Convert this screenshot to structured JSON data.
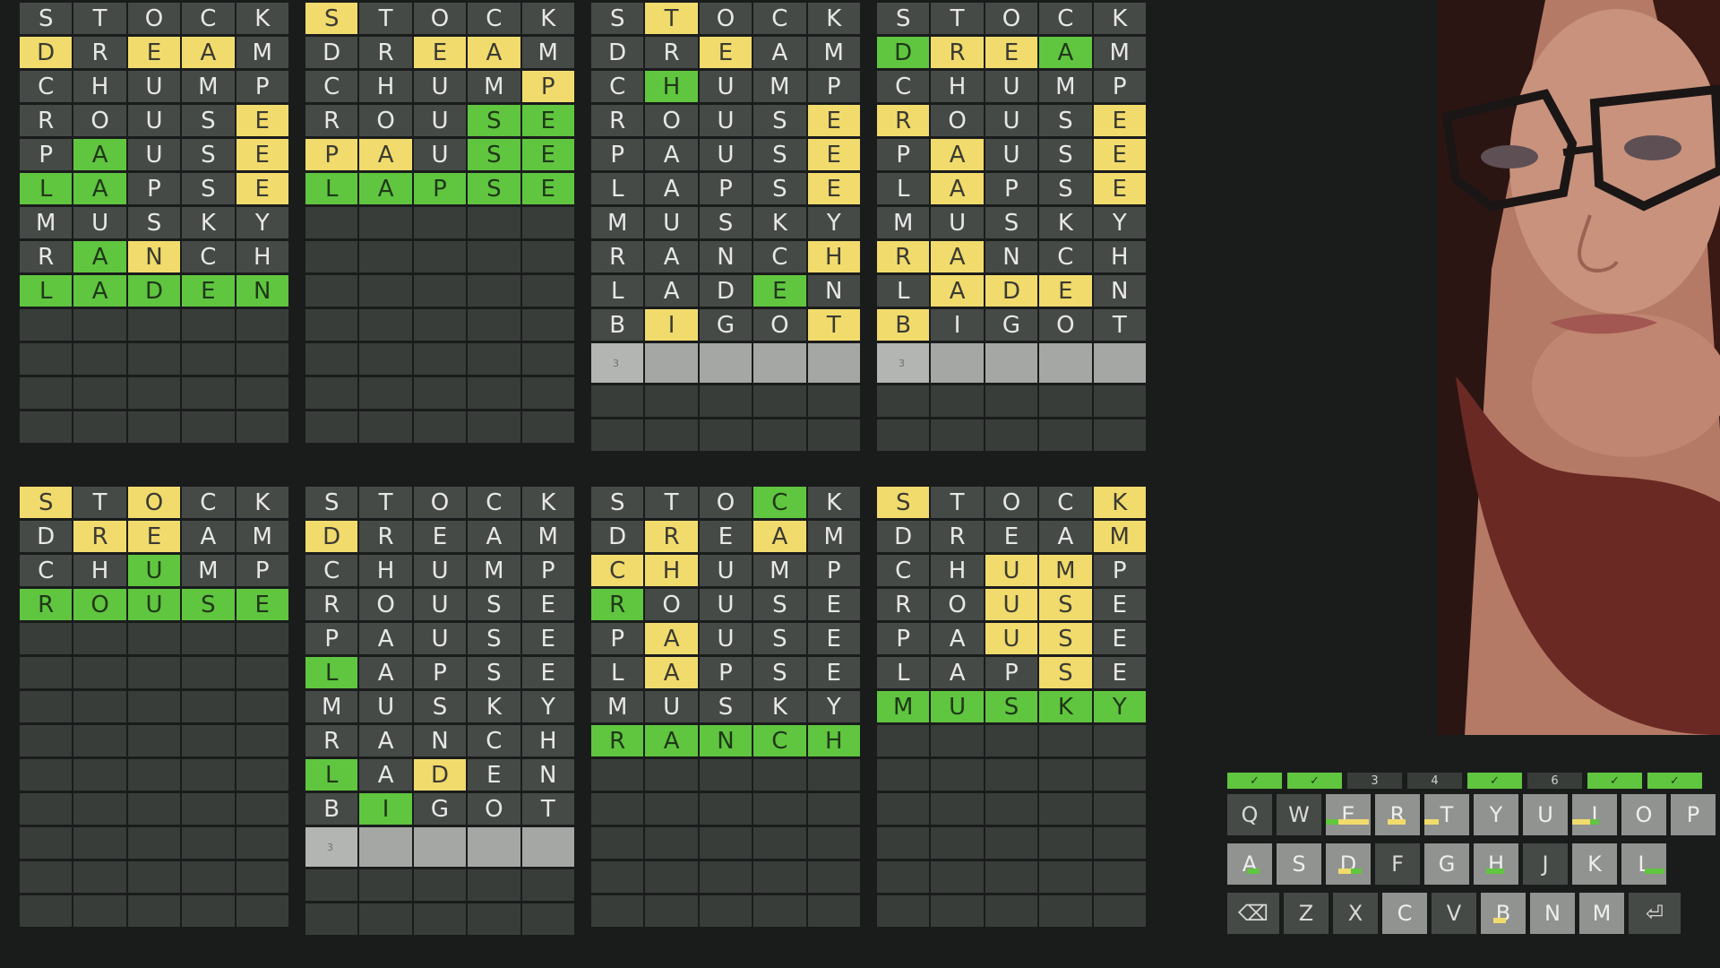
{
  "colors": {
    "background": "#1a1c1c",
    "empty_tile": "#393d3a",
    "guessed_tile": "#464a47",
    "yellow": "#f1db6c",
    "green": "#60c53f"
  },
  "guesses": [
    "STOCK",
    "DREAM",
    "CHUMP",
    "ROUSE",
    "PAUSE",
    "LAPSE",
    "MUSKY",
    "RANCH",
    "LADEN",
    "BIGOT"
  ],
  "boards": [
    {
      "status": "solved",
      "answer": "LADEN",
      "rows": [
        {
          "word": "STOCK",
          "s": "....."
        },
        {
          "word": "DREAM",
          "s": "y.yy."
        },
        {
          "word": "CHUMP",
          "s": "....."
        },
        {
          "word": "ROUSE",
          "s": "....y"
        },
        {
          "word": "PAUSE",
          "s": ".g..y"
        },
        {
          "word": "LAPSE",
          "s": "gg..y"
        },
        {
          "word": "MUSKY",
          "s": "....."
        },
        {
          "word": "RANCH",
          "s": ".gy.."
        },
        {
          "word": "LADEN",
          "s": "ggggg"
        }
      ],
      "current_row_hint": ""
    },
    {
      "status": "solved",
      "answer": "LAPSE",
      "rows": [
        {
          "word": "STOCK",
          "s": "y...."
        },
        {
          "word": "DREAM",
          "s": "..yy."
        },
        {
          "word": "CHUMP",
          "s": "....y"
        },
        {
          "word": "ROUSE",
          "s": "...gg"
        },
        {
          "word": "PAUSE",
          "s": "yy.gg"
        },
        {
          "word": "LAPSE",
          "s": "ggggg"
        }
      ],
      "current_row_hint": ""
    },
    {
      "status": "active",
      "rows": [
        {
          "word": "STOCK",
          "s": ".y..."
        },
        {
          "word": "DREAM",
          "s": "..y.."
        },
        {
          "word": "CHUMP",
          "s": ".g..."
        },
        {
          "word": "ROUSE",
          "s": "....y"
        },
        {
          "word": "PAUSE",
          "s": "....y"
        },
        {
          "word": "LAPSE",
          "s": "....y"
        },
        {
          "word": "MUSKY",
          "s": "....."
        },
        {
          "word": "RANCH",
          "s": "....y"
        },
        {
          "word": "LADEN",
          "s": "...g."
        },
        {
          "word": "BIGOT",
          "s": ".y..y"
        }
      ],
      "current_row_hint": "3"
    },
    {
      "status": "active",
      "rows": [
        {
          "word": "STOCK",
          "s": "....."
        },
        {
          "word": "DREAM",
          "s": "gyyg."
        },
        {
          "word": "CHUMP",
          "s": "....."
        },
        {
          "word": "ROUSE",
          "s": "y...y"
        },
        {
          "word": "PAUSE",
          "s": ".y..y"
        },
        {
          "word": "LAPSE",
          "s": ".y..y"
        },
        {
          "word": "MUSKY",
          "s": "....."
        },
        {
          "word": "RANCH",
          "s": "yy..."
        },
        {
          "word": "LADEN",
          "s": ".yyy."
        },
        {
          "word": "BIGOT",
          "s": "y...."
        }
      ],
      "current_row_hint": "3"
    },
    {
      "status": "solved",
      "answer": "ROUSE",
      "rows": [
        {
          "word": "STOCK",
          "s": "y.y.."
        },
        {
          "word": "DREAM",
          "s": ".yy.."
        },
        {
          "word": "CHUMP",
          "s": "..g.."
        },
        {
          "word": "ROUSE",
          "s": "ggggg"
        }
      ],
      "current_row_hint": ""
    },
    {
      "status": "active",
      "rows": [
        {
          "word": "STOCK",
          "s": "....."
        },
        {
          "word": "DREAM",
          "s": "y...."
        },
        {
          "word": "CHUMP",
          "s": "....."
        },
        {
          "word": "ROUSE",
          "s": "....."
        },
        {
          "word": "PAUSE",
          "s": "....."
        },
        {
          "word": "LAPSE",
          "s": "g...."
        },
        {
          "word": "MUSKY",
          "s": "....."
        },
        {
          "word": "RANCH",
          "s": "....."
        },
        {
          "word": "LADEN",
          "s": "g.y.."
        },
        {
          "word": "BIGOT",
          "s": ".g..."
        }
      ],
      "current_row_hint": "3"
    },
    {
      "status": "solved",
      "answer": "RANCH",
      "rows": [
        {
          "word": "STOCK",
          "s": "...g."
        },
        {
          "word": "DREAM",
          "s": ".y.y."
        },
        {
          "word": "CHUMP",
          "s": "yy..."
        },
        {
          "word": "ROUSE",
          "s": "g...."
        },
        {
          "word": "PAUSE",
          "s": ".y..."
        },
        {
          "word": "LAPSE",
          "s": ".y..."
        },
        {
          "word": "MUSKY",
          "s": "....."
        },
        {
          "word": "RANCH",
          "s": "ggggg"
        }
      ],
      "current_row_hint": ""
    },
    {
      "status": "solved",
      "answer": "MUSKY",
      "rows": [
        {
          "word": "STOCK",
          "s": "y...y"
        },
        {
          "word": "DREAM",
          "s": "....y"
        },
        {
          "word": "CHUMP",
          "s": "..yy."
        },
        {
          "word": "ROUSE",
          "s": "..yy."
        },
        {
          "word": "PAUSE",
          "s": "..yy."
        },
        {
          "word": "LAPSE",
          "s": "...y."
        },
        {
          "word": "MUSKY",
          "s": "ggggg"
        }
      ],
      "current_row_hint": ""
    }
  ],
  "keyboard": {
    "board_indicators": [
      "✓",
      "✓",
      "3",
      "4",
      "✓",
      "6",
      "✓",
      "✓"
    ],
    "rows": [
      [
        {
          "k": "Q",
          "style": "dark"
        },
        {
          "k": "W",
          "style": "dark"
        },
        {
          "k": "E",
          "style": "light",
          "marks": [
            {
              "c": "g",
              "l": 0,
              "w": 14
            },
            {
              "c": "y",
              "l": 14,
              "w": 34
            }
          ]
        },
        {
          "k": "R",
          "style": "light",
          "marks": [
            {
              "c": "y",
              "l": 14,
              "w": 20
            }
          ]
        },
        {
          "k": "T",
          "style": "light",
          "marks": [
            {
              "c": "y",
              "l": 0,
              "w": 16
            }
          ]
        },
        {
          "k": "Y",
          "style": "light"
        },
        {
          "k": "U",
          "style": "light"
        },
        {
          "k": "I",
          "style": "light",
          "marks": [
            {
              "c": "y",
              "l": 0,
              "w": 20
            },
            {
              "c": "g",
              "l": 20,
              "w": 10
            }
          ]
        },
        {
          "k": "O",
          "style": "light"
        },
        {
          "k": "P",
          "style": "light"
        }
      ],
      [
        {
          "k": "A",
          "style": "light",
          "marks": [
            {
              "c": "g",
              "l": 22,
              "w": 14
            }
          ]
        },
        {
          "k": "S",
          "style": "light"
        },
        {
          "k": "D",
          "style": "light",
          "marks": [
            {
              "c": "y",
              "l": 14,
              "w": 14
            },
            {
              "c": "g",
              "l": 28,
              "w": 12
            }
          ]
        },
        {
          "k": "F",
          "style": "dark"
        },
        {
          "k": "G",
          "style": "light"
        },
        {
          "k": "H",
          "style": "light",
          "marks": [
            {
              "c": "g",
              "l": 14,
              "w": 20
            }
          ]
        },
        {
          "k": "J",
          "style": "dark"
        },
        {
          "k": "K",
          "style": "light"
        },
        {
          "k": "L",
          "style": "light",
          "marks": [
            {
              "c": "g",
              "l": 26,
              "w": 22
            }
          ]
        }
      ],
      [
        {
          "k": "⌫",
          "style": "dark",
          "wide": true
        },
        {
          "k": "Z",
          "style": "dark"
        },
        {
          "k": "X",
          "style": "dark"
        },
        {
          "k": "C",
          "style": "light"
        },
        {
          "k": "V",
          "style": "dark"
        },
        {
          "k": "B",
          "style": "light",
          "marks": [
            {
              "c": "y",
              "l": 14,
              "w": 14
            }
          ]
        },
        {
          "k": "N",
          "style": "light"
        },
        {
          "k": "M",
          "style": "light"
        },
        {
          "k": "⏎",
          "style": "dark",
          "wide": true
        }
      ]
    ]
  }
}
